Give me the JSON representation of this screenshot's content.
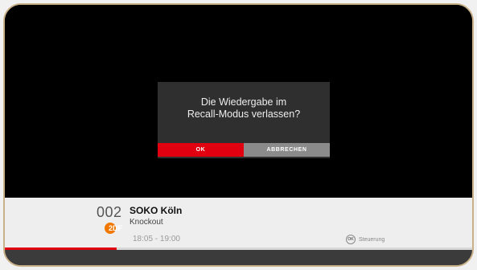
{
  "dialog": {
    "message_line1": "Die Wiedergabe im",
    "message_line2": "Recall-Modus verlassen?",
    "ok_label": "OK",
    "cancel_label": "ABBRECHEN"
  },
  "channel": {
    "number": "002",
    "logo_text": "2DF",
    "program_title": "SOKO Köln",
    "episode_title": "Knockout",
    "time_range": "18:05 - 19:00"
  },
  "hint": {
    "icon_label": "OK",
    "label": "Steuerung"
  },
  "progress": {
    "fraction": 0.24
  },
  "colors": {
    "accent": "#e0000f",
    "cancel": "#8b8b8b",
    "dialog_bg": "#2f2f2f",
    "zdf_orange": "#f07800"
  }
}
